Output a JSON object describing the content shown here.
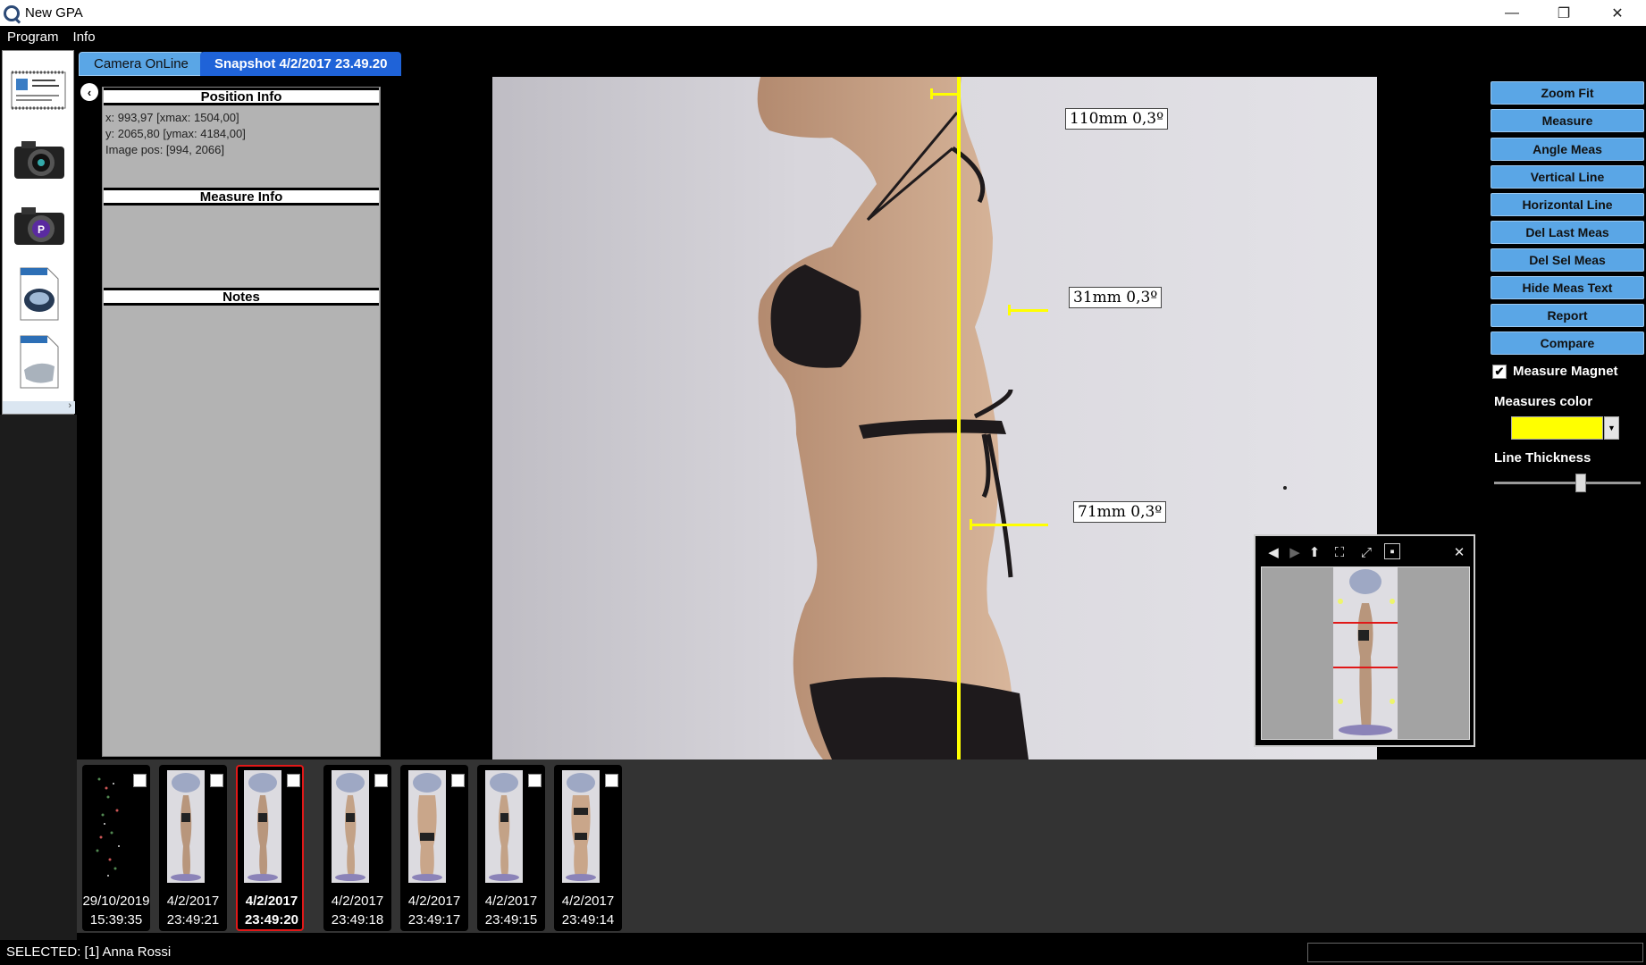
{
  "window": {
    "title": "New GPA",
    "minimize": "—",
    "restore": "❐",
    "close": "✕"
  },
  "menu": [
    "Program",
    "Info"
  ],
  "dock": {
    "items": [
      "patient-card-icon",
      "camera-icon",
      "camera-p-icon",
      "scanner-document-icon",
      "pillow-document-icon"
    ],
    "strip_arrow": "›"
  },
  "tabs": [
    {
      "label": "Camera OnLine",
      "active": false
    },
    {
      "label": "Snapshot 4/2/2017 23.49.20",
      "active": true
    }
  ],
  "info_panel": {
    "collapse_glyph": "‹",
    "position_header": "Position Info",
    "position_lines": [
      "x: 993,97 [xmax: 1504,00]",
      "y: 2065,80 [ymax: 4184,00]",
      "Image pos: [994, 2066]"
    ],
    "measure_header": "Measure Info",
    "notes_header": "Notes"
  },
  "measurements": {
    "color": "#ffff00",
    "labels": [
      "110mm  0,3º",
      "31mm  0,3º",
      "71mm  0,3º"
    ]
  },
  "right_panel": {
    "buttons": [
      "Zoom Fit",
      "Measure",
      "Angle Meas",
      "Vertical Line",
      "Horizontal Line",
      "Del Last Meas",
      "Del Sel Meas",
      "Hide Meas Text",
      "Report",
      "Compare"
    ],
    "magnet_label": "Measure Magnet",
    "magnet_checked": true,
    "magnet_check_glyph": "✔",
    "color_label": "Measures color",
    "color_dropdown_glyph": "▼",
    "thickness_label": "Line Thickness",
    "thickness_value": 0.6
  },
  "navigator": {
    "tools": [
      "◀",
      "▶",
      "⬆",
      "⛶",
      "⤢",
      "▪"
    ],
    "close": "✕"
  },
  "thumbnails": [
    {
      "date": "29/10/2019",
      "time": "15:39:35",
      "selected": false,
      "kind": "dark"
    },
    {
      "date": "4/2/2017",
      "time": "23:49:21",
      "selected": false,
      "kind": "side"
    },
    {
      "date": "4/2/2017",
      "time": "23:49:20",
      "selected": true,
      "kind": "side"
    },
    {
      "date": "4/2/2017",
      "time": "23:49:18",
      "selected": false,
      "kind": "side"
    },
    {
      "date": "4/2/2017",
      "time": "23:49:17",
      "selected": false,
      "kind": "back"
    },
    {
      "date": "4/2/2017",
      "time": "23:49:15",
      "selected": false,
      "kind": "side"
    },
    {
      "date": "4/2/2017",
      "time": "23:49:14",
      "selected": false,
      "kind": "front"
    }
  ],
  "status": {
    "text": "SELECTED: [1] Anna Rossi"
  }
}
